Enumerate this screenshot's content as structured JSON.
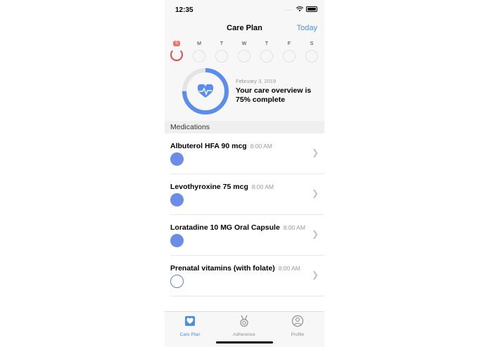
{
  "status_bar": {
    "time": "12:35",
    "signal": "....."
  },
  "nav": {
    "title": "Care Plan",
    "today_label": "Today"
  },
  "week": {
    "days": [
      {
        "label": "S",
        "today": true
      },
      {
        "label": "M",
        "today": false
      },
      {
        "label": "T",
        "today": false
      },
      {
        "label": "W",
        "today": false
      },
      {
        "label": "T",
        "today": false
      },
      {
        "label": "F",
        "today": false
      },
      {
        "label": "S",
        "today": false
      }
    ]
  },
  "overview": {
    "date": "February 3, 2019",
    "text": "Your care overview is 75% complete",
    "progress": 0.75
  },
  "section": {
    "title": "Medications"
  },
  "medications": [
    {
      "name": "Albuterol HFA 90 mcg",
      "time": "8:00 AM",
      "completed": true
    },
    {
      "name": "Levothyroxine 75 mcg",
      "time": "8:00 AM",
      "completed": true
    },
    {
      "name": "Loratadine 10 MG Oral Capsule",
      "time": "8:00 AM",
      "completed": true
    },
    {
      "name": "Prenatal vitamins (with folate)",
      "time": "8:00 AM",
      "completed": false
    }
  ],
  "tabs": [
    {
      "label": "Care Plan",
      "icon": "care-plan-icon",
      "active": true
    },
    {
      "label": "Adherence",
      "icon": "medal-icon",
      "active": false
    },
    {
      "label": "Profile",
      "icon": "profile-icon",
      "active": false
    }
  ],
  "colors": {
    "accent": "#4a90e2",
    "ring": "#5b8def",
    "today_ring": "#e84a4a",
    "dot": "#6b8de8"
  }
}
